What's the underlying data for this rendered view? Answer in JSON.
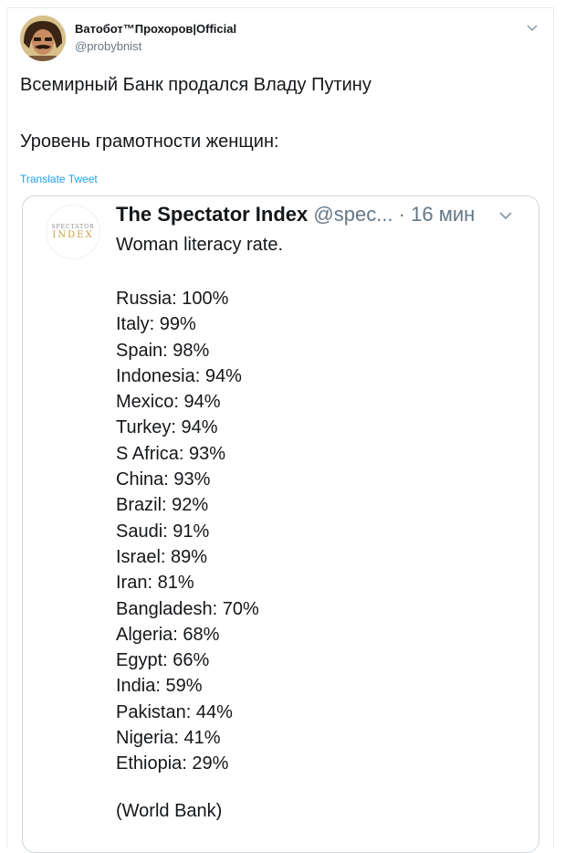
{
  "author": {
    "name": "Ватобот™Прохоров|Official",
    "handle": "@probybnist"
  },
  "tweet": {
    "line1": "Всемирный Банк продался Владу Путину",
    "line2": "Уровень грамотности женщин:",
    "translate_label": "Translate Tweet"
  },
  "quoted": {
    "avatar_top": "SPECTATOR",
    "avatar_bottom": "INDEX",
    "name": "The Spectator Index",
    "handle": "@spec...",
    "separator": "·",
    "time": "16 мин",
    "intro": "Woman literacy rate.",
    "items": [
      "Russia: 100%",
      "Italy: 99%",
      "Spain: 98%",
      "Indonesia: 94%",
      "Mexico: 94%",
      "Turkey: 94%",
      "S Africa: 93%",
      "China: 93%",
      "Brazil: 92%",
      "Saudi: 91%",
      "Israel: 89%",
      "Iran: 81%",
      "Bangladesh: 70%",
      "Algeria: 68%",
      "Egypt: 66%",
      "India: 59%",
      "Pakistan: 44%",
      "Nigeria: 41%",
      "Ethiopia: 29%"
    ],
    "source": "(World Bank)"
  },
  "colors": {
    "link": "#1da1f2",
    "secondary_text": "#657786",
    "border": "#ccd6dd"
  }
}
